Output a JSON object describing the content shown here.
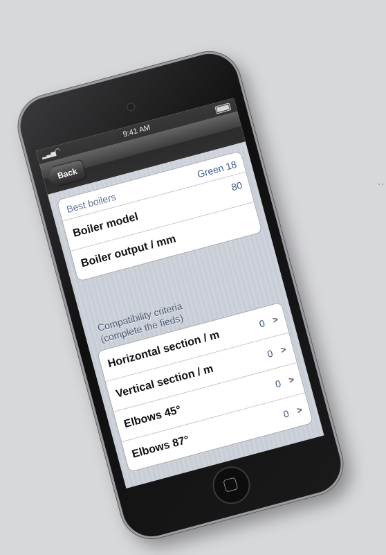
{
  "statusbar": {
    "time": "9:41 AM",
    "signal_icon": "signal-bars-icon",
    "wifi_icon": "wifi-icon",
    "battery_icon": "battery-icon"
  },
  "navbar": {
    "back_label": "Back"
  },
  "boilers": {
    "header_label": "Best boilers",
    "header_value": "Green 18",
    "rows": [
      {
        "label": "Boiler model",
        "value": "80"
      },
      {
        "label": "Boiler output / mm",
        "value": ""
      }
    ]
  },
  "criteria": {
    "title_line1": "Compatibility criteria",
    "title_line2": "(complete the fieds)",
    "rows": [
      {
        "label": "Horizontal section  / m",
        "value": "0"
      },
      {
        "label": "Vertical section  / m",
        "value": "0"
      },
      {
        "label": "Elbows  45°",
        "value": "0"
      },
      {
        "label": "Elbows  87°",
        "value": "0"
      }
    ]
  },
  "colors": {
    "accent": "#385487",
    "background": "#d7d8da",
    "navbar": "#1c1c1c"
  }
}
